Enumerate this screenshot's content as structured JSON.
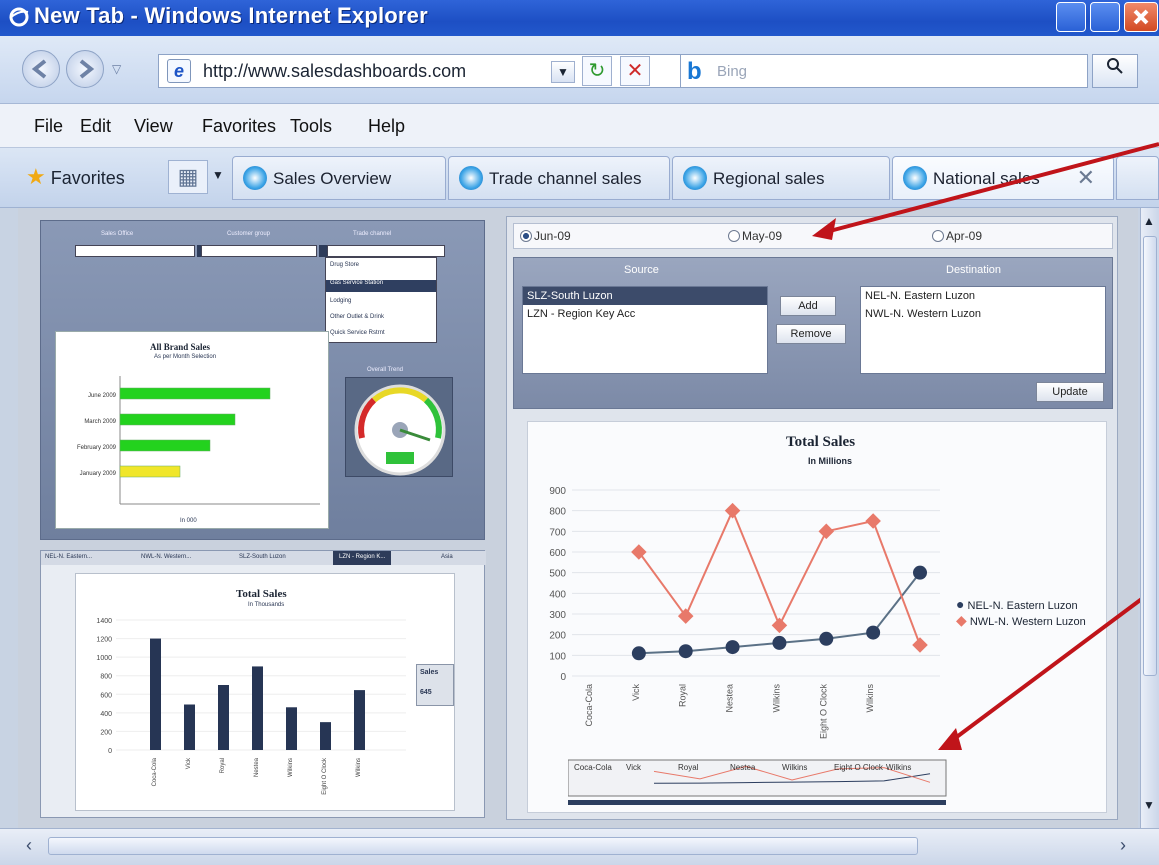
{
  "window": {
    "title": "New Tab - Windows Internet Explorer"
  },
  "address": {
    "url": "http://www.salesdashboards.com",
    "search_placeholder": "Bing"
  },
  "menu": [
    "File",
    "Edit",
    "View",
    "Favorites",
    "Tools",
    "Help"
  ],
  "favorites_label": "Favorites",
  "tabs": [
    {
      "label": "Sales Overview"
    },
    {
      "label": "Trade channel sales"
    },
    {
      "label": "Regional sales"
    },
    {
      "label": "National sales",
      "active": true
    }
  ],
  "left_top": {
    "filters": [
      "Sales Office",
      "Customer group",
      "Trade channel"
    ],
    "dropdown_items": [
      "Drug Store",
      "Gas Service Station",
      "Lodging",
      "Other Outlet & Drink",
      "Quick Service Rstrnt"
    ],
    "bar_chart": {
      "title": "All Brand Sales",
      "subtitle": "As per Month Selection",
      "xlabel": "In 000",
      "categories": [
        "June 2009",
        "March 2009",
        "February 2009",
        "January 2009"
      ],
      "values": [
        30,
        23,
        18,
        12
      ],
      "colors": [
        "#23d21e",
        "#23d21e",
        "#23d21e",
        "#f0e62a"
      ]
    },
    "gauge_title": "Overall Trend"
  },
  "left_bottom": {
    "tabs": [
      "NEL-N. Eastern...",
      "NWL-N. Western...",
      "SLZ-South Luzon",
      "LZN - Region K...",
      "Asia"
    ],
    "chart_title": "Total Sales",
    "chart_subtitle": "In Thousands",
    "tooltip": {
      "label": "Sales",
      "value": "645"
    }
  },
  "right": {
    "months": [
      "Jun-09",
      "May-09",
      "Apr-09"
    ],
    "selected_month": "Jun-09",
    "source_header": "Source",
    "destination_header": "Destination",
    "source_items": [
      "SLZ-South Luzon",
      "LZN - Region Key Acc"
    ],
    "destination_items": [
      "NEL-N. Eastern Luzon",
      "NWL-N. Western Luzon"
    ],
    "add_label": "Add",
    "remove_label": "Remove",
    "update_label": "Update",
    "chart_title": "Total Sales",
    "chart_subtitle": "In Millions"
  },
  "chart_data": [
    {
      "type": "line",
      "title": "Total Sales",
      "subtitle": "In Millions",
      "categories": [
        "Coca-Cola",
        "Vick",
        "Royal",
        "Nestea",
        "Wilkins",
        "Eight O Clock",
        "Wilkins"
      ],
      "ylim": [
        0,
        900
      ],
      "yticks": [
        0,
        100,
        200,
        300,
        400,
        500,
        600,
        700,
        800,
        900
      ],
      "series": [
        {
          "name": "NEL-N. Eastern Luzon",
          "color": "#2c3e5f",
          "values": [
            null,
            110,
            120,
            140,
            160,
            180,
            210,
            500
          ]
        },
        {
          "name": "NWL-N. Western Luzon",
          "color": "#e8796a",
          "values": [
            null,
            600,
            290,
            800,
            245,
            700,
            750,
            150
          ]
        }
      ],
      "legend": "right"
    },
    {
      "type": "bar",
      "title": "Total Sales",
      "subtitle": "In Thousands",
      "categories": [
        "Coca-Cola",
        "Vick",
        "Royal",
        "Nestea",
        "Wilkins",
        "Eight O Clock",
        "Wilkins"
      ],
      "values": [
        1200,
        490,
        700,
        900,
        460,
        300,
        645
      ],
      "ylim": [
        0,
        1400
      ],
      "yticks": [
        0,
        200,
        400,
        600,
        800,
        1000,
        1200,
        1400
      ]
    }
  ]
}
